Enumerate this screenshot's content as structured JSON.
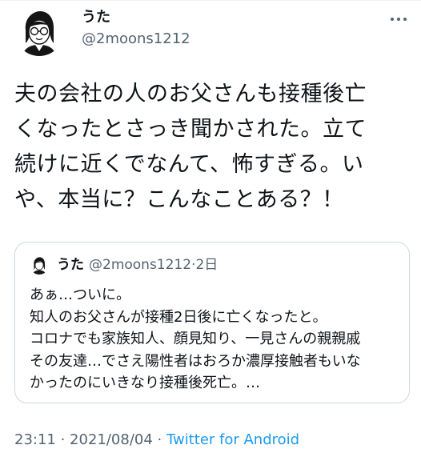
{
  "author": {
    "display_name": "うた",
    "handle": "@2moons1212"
  },
  "tweet": {
    "text": "夫の会社の人のお父さんも接種後亡\nくなったとさっき聞かされた。立て\n続けに近くでなんて、怖すぎる。い\nや、本当に？こんなことある？！"
  },
  "quoted_tweet": {
    "display_name": "うた",
    "handle": "@2moons1212",
    "separator": "·",
    "time": "2日",
    "text": "あぁ…ついに。\n知人のお父さんが接種2日後に亡くなったと。\nコロナでも家族知人、顔見知り、一見さんの親親戚\nその友達…でさえ陽性者はおろか濃厚接触者もいな\nかったのにいきなり接種後死亡。…"
  },
  "meta": {
    "time": "23:11",
    "separator1": " · ",
    "date": "2021/08/04",
    "separator2": " · ",
    "source": "Twitter for Android"
  },
  "colors": {
    "text_primary": "#0f1419",
    "text_secondary": "#536471",
    "link": "#1d9bf0",
    "border": "#cfd9de"
  },
  "icons": {
    "more": "more-horizontal-icon",
    "avatar": "avatar-illustration"
  }
}
